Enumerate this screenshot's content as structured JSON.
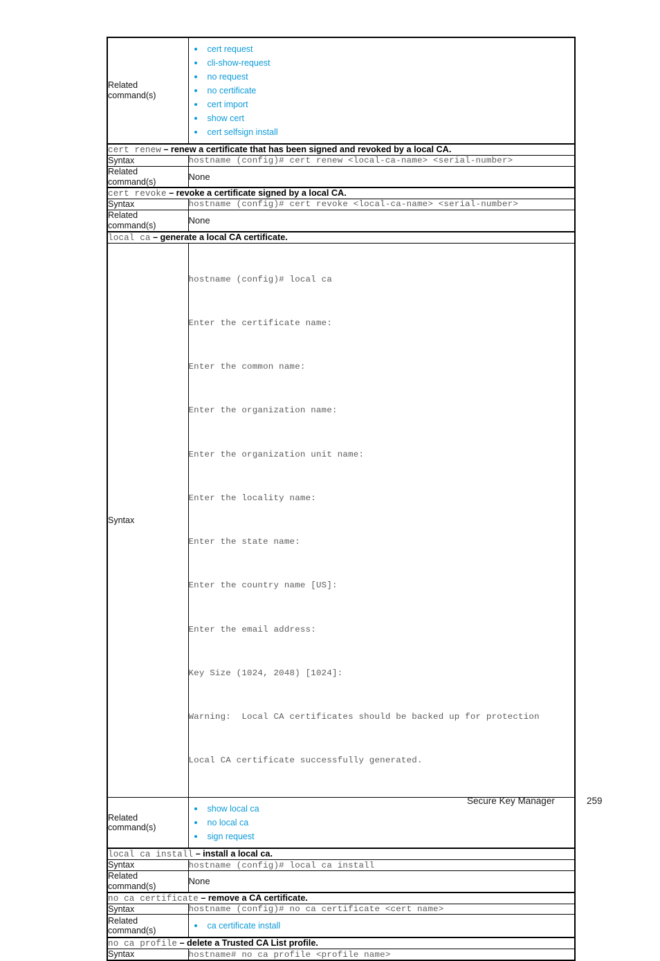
{
  "page": {
    "footer_title": "Secure Key Manager",
    "footer_page_number": "259",
    "link_color": "#0b9ad8",
    "mono_color": "#5a5a5a"
  },
  "labels": {
    "related_commands": "Related\ncommand(s)",
    "related_commands_line1": "Related",
    "related_commands_line2": "command(s)",
    "syntax": "Syntax",
    "none": "None",
    "dash": "–"
  },
  "blocks": [
    {
      "id": "cert-request-related",
      "related_label_line1": "Related",
      "related_label_line2": "command(s)",
      "related_links": [
        "cert request",
        "cli-show-request",
        "no request",
        "no certificate",
        "cert import",
        "show cert",
        "cert selfsign install"
      ]
    },
    {
      "id": "cert-renew",
      "command": "cert renew",
      "description": "renew a certificate that has been signed and revoked by a local CA.",
      "syntax_label": "Syntax",
      "syntax": "hostname (config)# cert renew <local-ca-name> <serial-number>",
      "related_label_line1": "Related",
      "related_label_line2": "command(s)",
      "related_none": "None"
    },
    {
      "id": "cert-revoke",
      "command": "cert revoke",
      "description": "revoke a certificate signed by a local CA.",
      "syntax_label": "Syntax",
      "syntax": "hostname (config)# cert revoke <local-ca-name> <serial-number>",
      "related_label_line1": "Related",
      "related_label_line2": "command(s)",
      "related_none": "None"
    },
    {
      "id": "local-ca",
      "command": "local ca",
      "description": "generate a local CA certificate.",
      "syntax_label": "Syntax",
      "syntax_lines": [
        "hostname (config)# local ca",
        "Enter the certificate name:",
        "Enter the common name:",
        "Enter the organization name:",
        "Enter the organization unit name:",
        "Enter the locality name:",
        "Enter the state name:",
        "Enter the country name [US]:",
        "Enter the email address:",
        "Key Size (1024, 2048) [1024]:",
        "Warning:  Local CA certificates should be backed up for protection",
        "Local CA certificate successfully generated."
      ],
      "related_label_line1": "Related",
      "related_label_line2": "command(s)",
      "related_links": [
        "show local ca",
        "no local ca",
        "sign request"
      ]
    },
    {
      "id": "local-ca-install",
      "command": "local ca install",
      "description": "install a local ca.",
      "syntax_label": "Syntax",
      "syntax": "hostname (config)# local ca install",
      "related_label_line1": "Related",
      "related_label_line2": "command(s)",
      "related_none": "None"
    },
    {
      "id": "no-ca-certificate",
      "command": "no ca certificate",
      "description": "remove a CA certificate.",
      "syntax_label": "Syntax",
      "syntax": "hostname (config)# no ca certificate <cert name>",
      "related_label_line1": "Related",
      "related_label_line2": "command(s)",
      "related_links": [
        "ca certificate install"
      ]
    },
    {
      "id": "no-ca-profile",
      "command": "no ca profile",
      "description": "delete a Trusted CA List profile.",
      "syntax_label": "Syntax",
      "syntax": "hostname# no ca profile <profile name>"
    }
  ]
}
